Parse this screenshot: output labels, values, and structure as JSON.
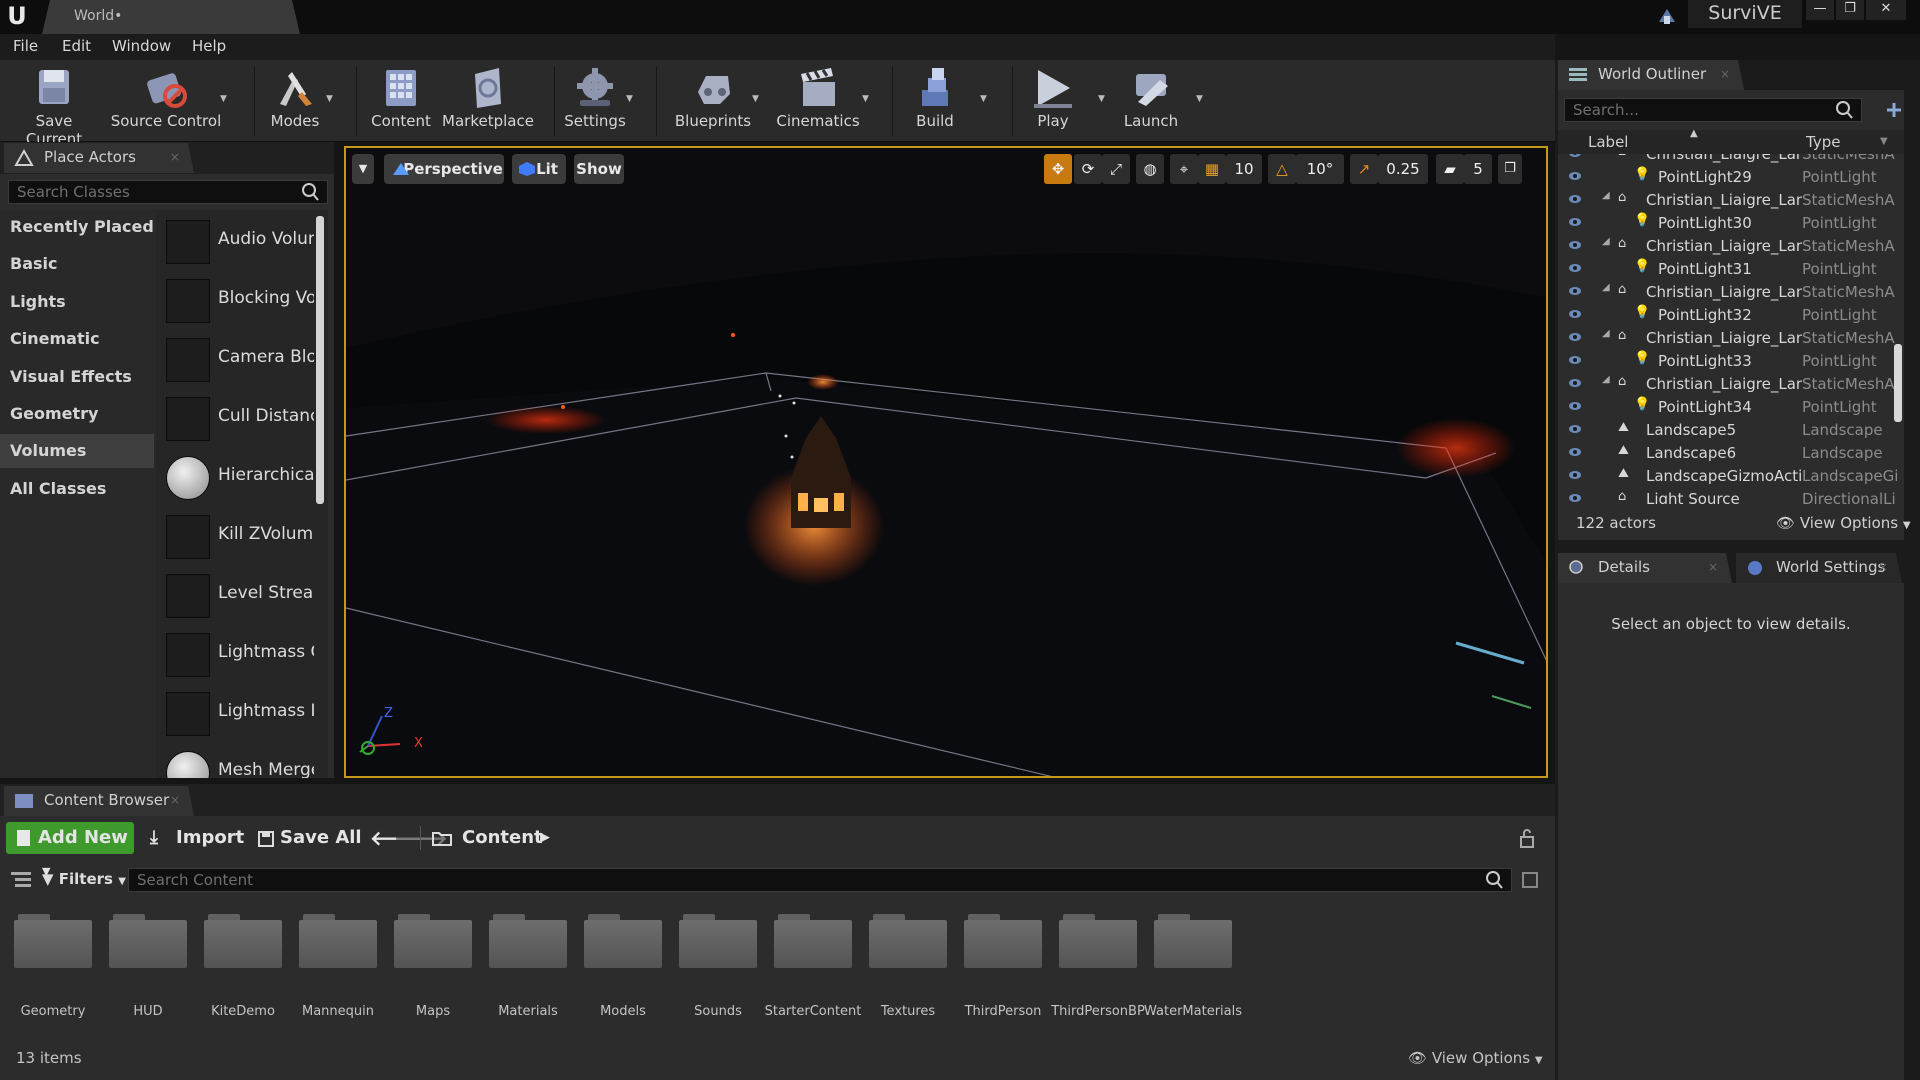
{
  "titlebar": {
    "doc_tab": "World•",
    "project": "SurviVE",
    "minimize": "—",
    "restore": "❐",
    "close": "✕"
  },
  "menu": [
    "File",
    "Edit",
    "Window",
    "Help"
  ],
  "toolbar": [
    "Save Current",
    "Source Control",
    "Modes",
    "Content",
    "Marketplace",
    "Settings",
    "Blueprints",
    "Cinematics",
    "Build",
    "Play",
    "Launch"
  ],
  "place_actors": {
    "tab": "Place Actors",
    "search_placeholder": "Search Classes",
    "categories": [
      "Recently Placed",
      "Basic",
      "Lights",
      "Cinematic",
      "Visual Effects",
      "Geometry",
      "Volumes",
      "All Classes"
    ],
    "selected_category": "Volumes",
    "items": [
      "Audio Volume",
      "Blocking Volume",
      "Camera Blocking Volume",
      "Cull Distance Volume",
      "Hierarchical LOD Volume",
      "Kill ZVolume",
      "Level Streaming Volume",
      "Lightmass Character Indirect Detail Volume",
      "Lightmass Importance Volume",
      "Mesh Merge Cull Volume"
    ]
  },
  "viewport": {
    "perspective": "Perspective",
    "lit": "Lit",
    "show": "Show",
    "grid_snap": "10",
    "rotation_snap": "10°",
    "scale_snap": "0.25",
    "camera_speed": "5",
    "axis_x": "X",
    "axis_z": "Z"
  },
  "outliner": {
    "tab": "World Outliner",
    "search_placeholder": "Search...",
    "col_label": "Label",
    "col_type": "Type",
    "rows": [
      {
        "label": "Christian_Liaigre_Lant",
        "type": "StaticMeshA",
        "child": false
      },
      {
        "label": "PointLight29",
        "type": "PointLight",
        "child": true
      },
      {
        "label": "Christian_Liaigre_Lant",
        "type": "StaticMeshA",
        "child": false
      },
      {
        "label": "PointLight30",
        "type": "PointLight",
        "child": true
      },
      {
        "label": "Christian_Liaigre_Lant",
        "type": "StaticMeshA",
        "child": false
      },
      {
        "label": "PointLight31",
        "type": "PointLight",
        "child": true
      },
      {
        "label": "Christian_Liaigre_Lant",
        "type": "StaticMeshA",
        "child": false
      },
      {
        "label": "PointLight32",
        "type": "PointLight",
        "child": true
      },
      {
        "label": "Christian_Liaigre_Lant",
        "type": "StaticMeshA",
        "child": false
      },
      {
        "label": "PointLight33",
        "type": "PointLight",
        "child": true
      },
      {
        "label": "Christian_Liaigre_Lant",
        "type": "StaticMeshA",
        "child": false
      },
      {
        "label": "PointLight34",
        "type": "PointLight",
        "child": true
      },
      {
        "label": "Landscape5",
        "type": "Landscape",
        "child": false
      },
      {
        "label": "Landscape6",
        "type": "Landscape",
        "child": false
      },
      {
        "label": "LandscapeGizmoActiv",
        "type": "LandscapeGi",
        "child": false
      },
      {
        "label": "Light Source",
        "type": "DirectionalLi",
        "child": false
      }
    ],
    "count": "122 actors",
    "view_options": "View Options"
  },
  "details": {
    "tab": "Details",
    "tab2": "World Settings",
    "message": "Select an object to view details."
  },
  "content_browser": {
    "tab": "Content Browser",
    "add_new": "Add New",
    "import": "Import",
    "save_all": "Save All",
    "path": "Content",
    "filters": "Filters",
    "search_placeholder": "Search Content",
    "folders": [
      "Geometry",
      "HUD",
      "KiteDemo",
      "Mannequin",
      "Maps",
      "Materials",
      "Models",
      "Sounds",
      "StarterContent",
      "Textures",
      "ThirdPerson",
      "ThirdPersonBP",
      "WaterMaterials"
    ],
    "count": "13 items",
    "view_options": "View Options"
  },
  "colors": {
    "accent_green": "#3f9a2e",
    "viewport_border": "#c6971d",
    "editor_bg": "#2c2c2c"
  }
}
